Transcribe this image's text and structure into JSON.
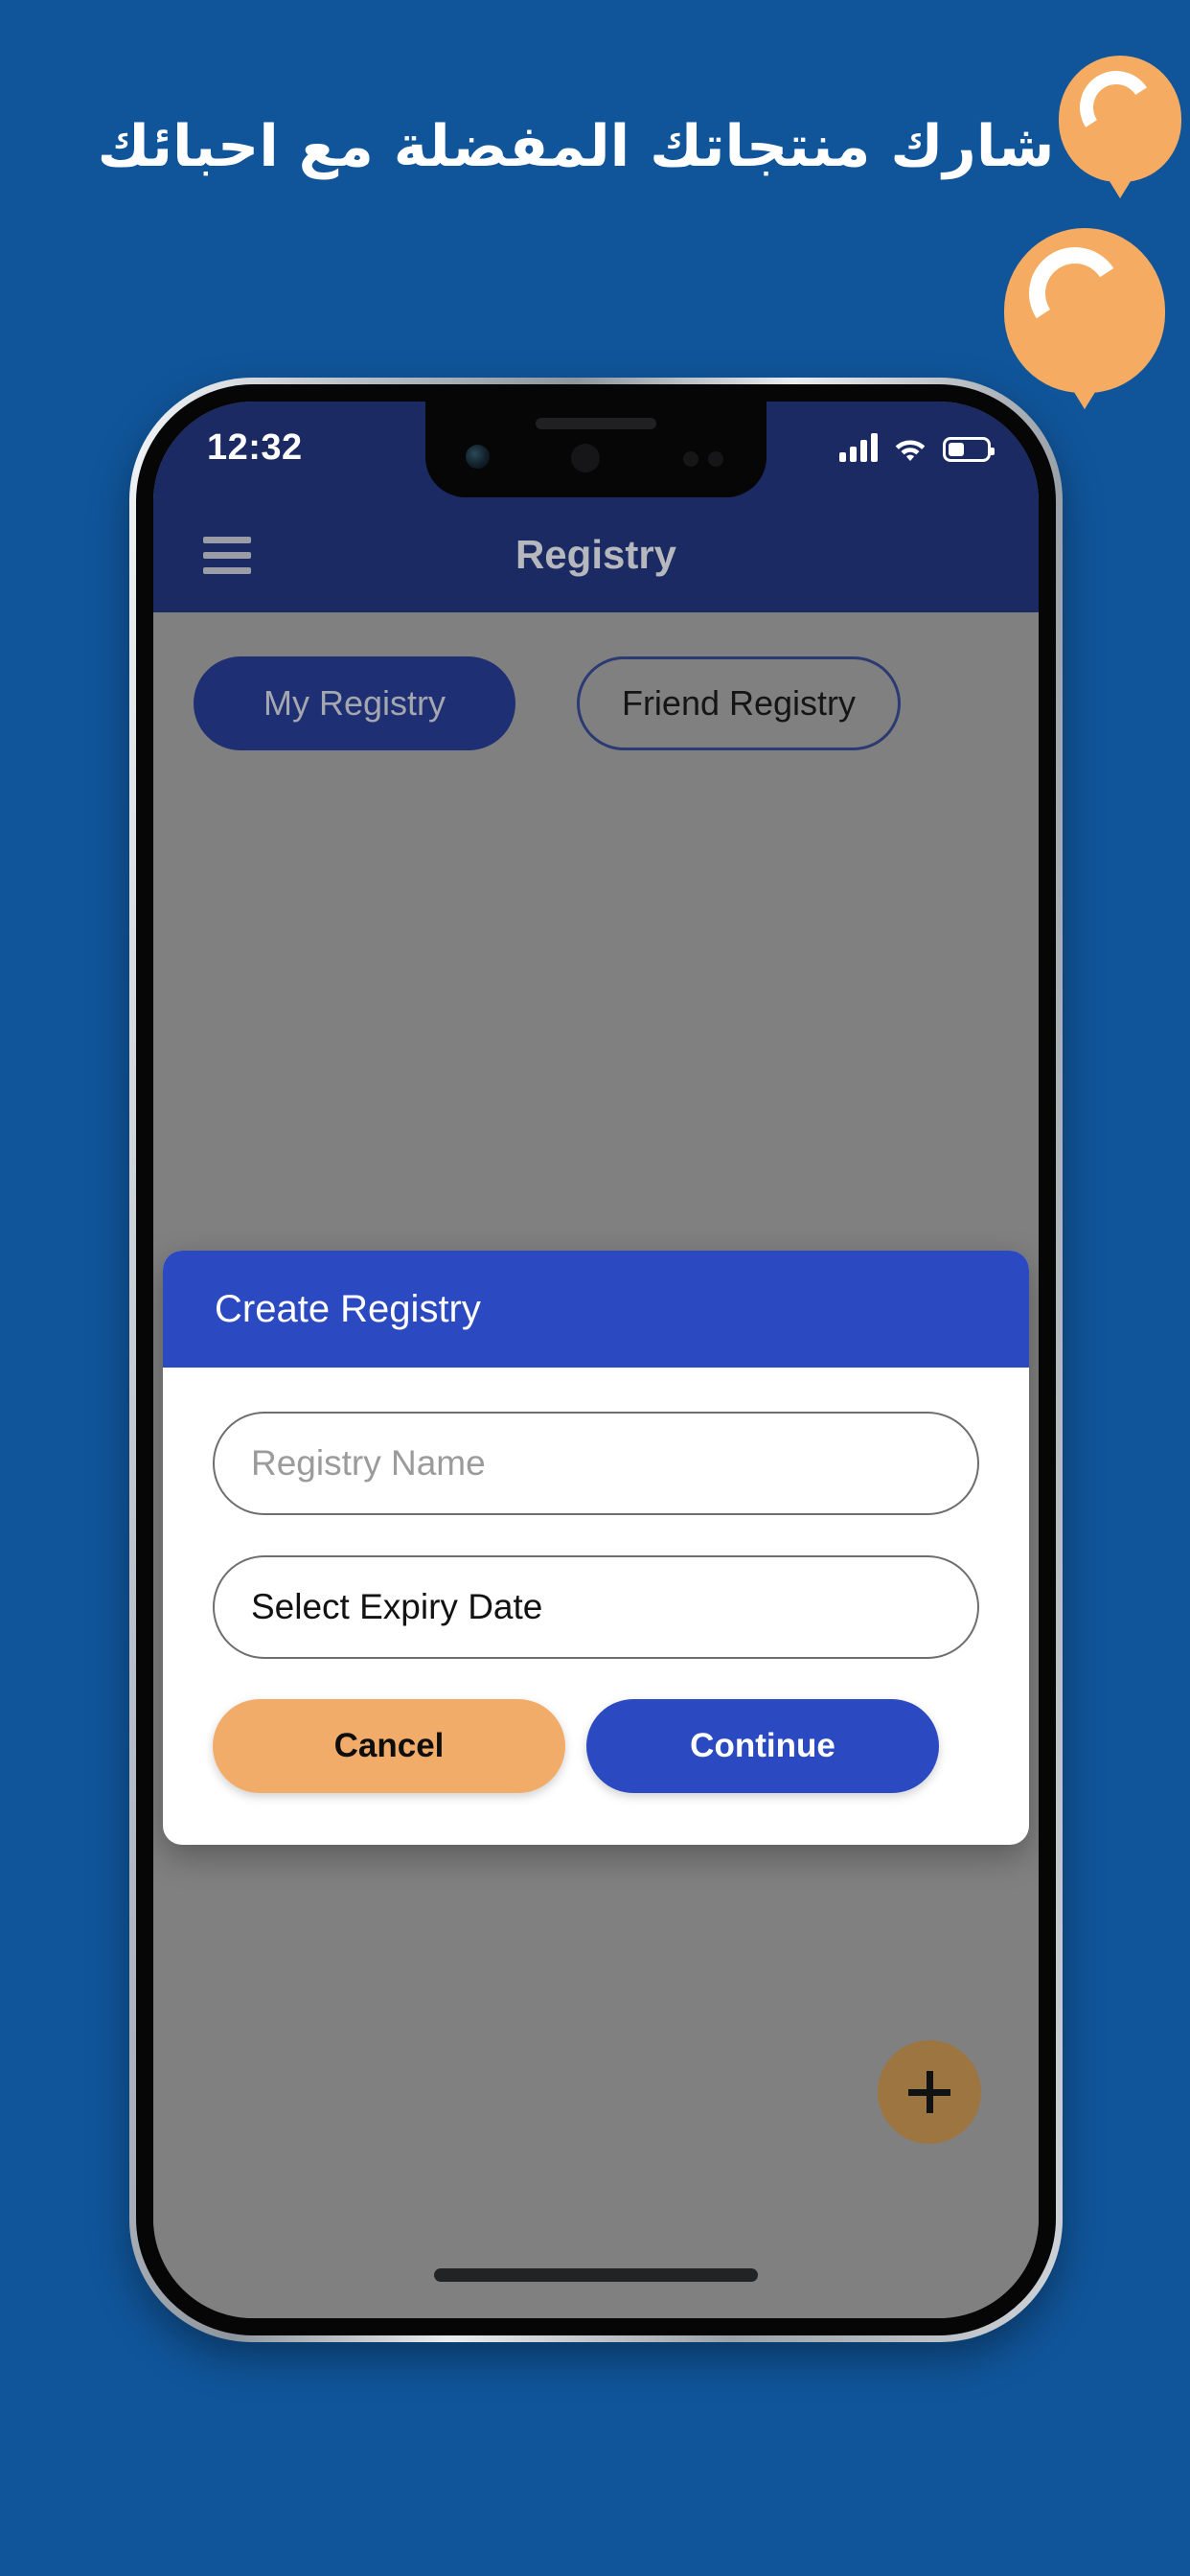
{
  "promo": {
    "headline": "شارك منتجاتك المفضلة مع احبائك",
    "background_color": "#10559A",
    "balloon_color": "#F5AC62"
  },
  "status_bar": {
    "time": "12:32",
    "signal_icon": "signal-bars-icon",
    "wifi_icon": "wifi-icon",
    "battery_icon": "battery-icon",
    "battery_level_percent": 42
  },
  "app_bar": {
    "menu_icon": "hamburger-menu-icon",
    "title": "Registry",
    "background_color": "#1B2A63",
    "title_color": "#B6B8BD"
  },
  "tabs": [
    {
      "label": "My Registry",
      "active": true
    },
    {
      "label": "Friend Registry",
      "active": false
    }
  ],
  "fab": {
    "icon": "plus-icon",
    "color": "#9D7540"
  },
  "dialog": {
    "title": "Create Registry",
    "header_color": "#2B49C0",
    "fields": [
      {
        "name": "registry-name",
        "placeholder": "Registry Name",
        "value": ""
      },
      {
        "name": "expiry-date",
        "placeholder": "Select Expiry Date",
        "value": "Select Expiry Date"
      }
    ],
    "buttons": {
      "cancel": "Cancel",
      "continue": "Continue",
      "cancel_color": "#F2AC6A",
      "continue_color": "#2B49C0"
    }
  }
}
